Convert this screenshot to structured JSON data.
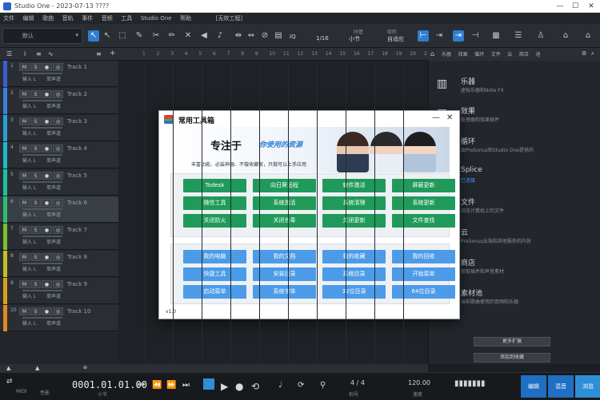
{
  "window": {
    "title": "Studio One - 2023-07-13 ????",
    "minimize": "—",
    "maximize": "☐",
    "close": "✕"
  },
  "menu": [
    "文件",
    "编辑",
    "歌曲",
    "音轨",
    "事件",
    "音频",
    "工具",
    "Studio One",
    "帮助",
    "[无效工程]"
  ],
  "toolbar": {
    "preset": "默认",
    "quantize_label": "IQ",
    "quantize_value": "1/16",
    "timebase_label": "时基",
    "timebase_value": "小节",
    "snap_label": "吸附",
    "snap_value": "自适应"
  },
  "tracks": [
    {
      "num": "1",
      "name": "Track 1",
      "color": "#3a5fd0",
      "input": "输入 L",
      "mon": "单声道"
    },
    {
      "num": "2",
      "name": "Track 2",
      "color": "#3a7fd8",
      "input": "输入 L",
      "mon": "单声道"
    },
    {
      "num": "3",
      "name": "Track 3",
      "color": "#27a0d8",
      "input": "输入 L",
      "mon": "单声道"
    },
    {
      "num": "4",
      "name": "Track 4",
      "color": "#20b8c8",
      "input": "输入 L",
      "mon": "单声道"
    },
    {
      "num": "5",
      "name": "Track 5",
      "color": "#1fc0a0",
      "input": "输入 L",
      "mon": "单声道"
    },
    {
      "num": "6",
      "name": "Track 6",
      "color": "#2bc070",
      "input": "输入 L",
      "mon": "单声道"
    },
    {
      "num": "7",
      "name": "Track 7",
      "color": "#7ac030",
      "input": "输入 L",
      "mon": "单声道"
    },
    {
      "num": "8",
      "name": "Track 8",
      "color": "#c0c020",
      "input": "输入 L",
      "mon": "单声道"
    },
    {
      "num": "9",
      "name": "Track 9",
      "color": "#d8a020",
      "input": "输入 L",
      "mon": "单声道"
    },
    {
      "num": "10",
      "name": "Track 10",
      "color": "#e08a20",
      "input": "输入 L",
      "mon": "单声道"
    }
  ],
  "track_buttons": [
    "M",
    "S",
    "●",
    "◎"
  ],
  "ruler": [
    "1",
    "2",
    "3",
    "4",
    "5",
    "6",
    "7",
    "8",
    "9",
    "10",
    "11",
    "12",
    "13",
    "14",
    "15",
    "16",
    "17",
    "18",
    "19",
    "20",
    "21",
    "22"
  ],
  "browser": {
    "tabs": [
      "乐器",
      "效果",
      "循环",
      "文件",
      "云",
      "商店",
      "池"
    ],
    "items": [
      {
        "title": "乐器",
        "sub": "虚拟乐器和Note FX"
      },
      {
        "title": "效果",
        "sub": "处理器和效果插件"
      },
      {
        "title": "循环",
        "sub": "由PreSonus和Studio One提供的"
      },
      {
        "title": "Splice",
        "sub": "已连接",
        "link": true
      },
      {
        "title": "文件",
        "sub": "浏览计算机上的文件"
      },
      {
        "title": "云",
        "sub": "PreSonus云端和其他服务的内容"
      },
      {
        "title": "商店",
        "sub": "获取插件和声音素材"
      },
      {
        "title": "素材池",
        "sub": "当前歌曲使用的音频和乐器"
      }
    ],
    "btn1": "更多扩展",
    "btn2": "添加到收藏"
  },
  "transport": {
    "time": "0001.01.01.00",
    "time_label": "小节",
    "midi": "MIDI",
    "perf": "性能",
    "sig": "4 / 4",
    "sig_label": "拍号",
    "tempo": "120.00",
    "tempo_label": "速度",
    "tabs": [
      "编辑",
      "混音",
      "浏览"
    ]
  },
  "dialog": {
    "title": "常用工具箱",
    "slogan": "专注于",
    "slogan2": "你使用的资源",
    "sub": "丰富功能、必装神器、不做收藏家，只做可以上手应用",
    "group1": [
      "Todesk",
      "向日葵远程",
      "软件激活",
      "屏蔽更新",
      "微信工具",
      "系统激活",
      "系统清理",
      "系统更新",
      "关闭防火",
      "关闭杀毒",
      "关闭更新",
      "文件查找"
    ],
    "group2": [
      "我的电脑",
      "我的文档",
      "我的收藏",
      "我的回收",
      "快捷工具",
      "安装目录",
      "系统目录",
      "开始菜单",
      "启动菜单",
      "系统字体",
      "32位目录",
      "64位目录"
    ],
    "version": "v1.0"
  },
  "colors": {
    "accent": "#2f8fd6",
    "green_btn": "#1f9a5a",
    "blue_btn": "#4c9be8"
  }
}
